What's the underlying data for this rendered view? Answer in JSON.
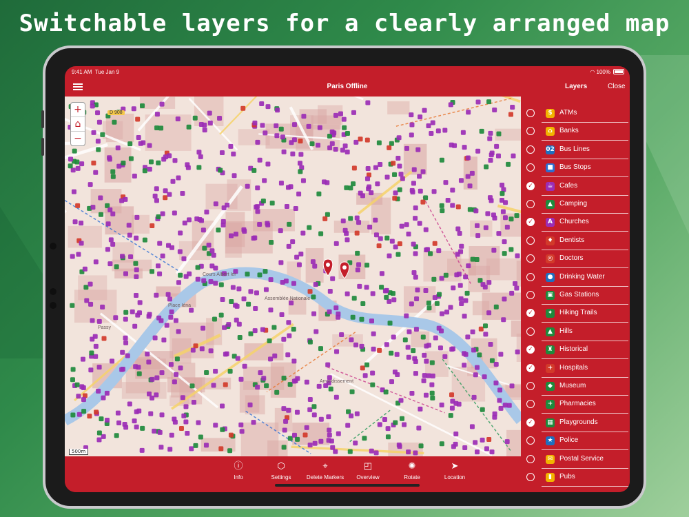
{
  "headline": "Switchable layers for a clearly arranged map",
  "status_bar": {
    "time": "9:41 AM",
    "date": "Tue Jan 9",
    "battery": "100%"
  },
  "nav": {
    "title": "Paris Offline",
    "layers_label": "Layers",
    "close_label": "Close"
  },
  "map": {
    "scale_label": "500m",
    "road_label": "D 908",
    "place_labels": [
      "Cours Albert Ier",
      "Assemblée Nationale",
      "Place Iéna",
      "Passy",
      "Arrondissement"
    ],
    "colors": {
      "base": "#f2e4dc",
      "blocks": "#d9a6a3",
      "river": "#a9c8e8",
      "poi_purple": "#9b2db5",
      "poi_green": "#1e8a3c"
    }
  },
  "toolbar": [
    {
      "label": "Info",
      "icon": "info-icon",
      "glyph": "ⓘ"
    },
    {
      "label": "Settings",
      "icon": "cube-icon",
      "glyph": "⬡"
    },
    {
      "label": "Delete Markers",
      "icon": "pin-icon",
      "glyph": "⌖"
    },
    {
      "label": "Overview",
      "icon": "overview-icon",
      "glyph": "◰"
    },
    {
      "label": "Rotate",
      "icon": "compass-icon",
      "glyph": "✺"
    },
    {
      "label": "Location",
      "icon": "location-arrow-icon",
      "glyph": "➤"
    }
  ],
  "layers": [
    {
      "label": "ATMs",
      "checked": false,
      "icon": "atm-icon",
      "glyph": "$",
      "color": "#f2b300"
    },
    {
      "label": "Banks",
      "checked": false,
      "icon": "bank-icon",
      "glyph": "⌂",
      "color": "#f2b300"
    },
    {
      "label": "Bus Lines",
      "checked": false,
      "icon": "bus-line-icon",
      "glyph": "02",
      "color": "#1e6fbf"
    },
    {
      "label": "Bus Stops",
      "checked": false,
      "icon": "bus-stop-icon",
      "glyph": "■",
      "color": "#2d6fd0"
    },
    {
      "label": "Cafes",
      "checked": true,
      "icon": "cafe-icon",
      "glyph": "☕",
      "color": "#9b2db5"
    },
    {
      "label": "Camping",
      "checked": false,
      "icon": "camping-icon",
      "glyph": "▲",
      "color": "#1e8a3c"
    },
    {
      "label": "Churches",
      "checked": true,
      "icon": "church-icon",
      "glyph": "A",
      "color": "#9b2db5"
    },
    {
      "label": "Dentists",
      "checked": false,
      "icon": "dentist-icon",
      "glyph": "♦",
      "color": "#d23a2a"
    },
    {
      "label": "Doctors",
      "checked": false,
      "icon": "doctor-icon",
      "glyph": "◎",
      "color": "#d23a2a"
    },
    {
      "label": "Drinking Water",
      "checked": false,
      "icon": "water-icon",
      "glyph": "●",
      "color": "#1e6fbf"
    },
    {
      "label": "Gas Stations",
      "checked": false,
      "icon": "gas-station-icon",
      "glyph": "▣",
      "color": "#1e8a3c"
    },
    {
      "label": "Hiking Trails",
      "checked": true,
      "icon": "hiking-icon",
      "glyph": "✦",
      "color": "#1e8a3c"
    },
    {
      "label": "Hills",
      "checked": false,
      "icon": "hill-icon",
      "glyph": "▲",
      "color": "#1e8a3c"
    },
    {
      "label": "Historical",
      "checked": true,
      "icon": "historical-icon",
      "glyph": "♜",
      "color": "#1e8a3c"
    },
    {
      "label": "Hospitals",
      "checked": true,
      "icon": "hospital-icon",
      "glyph": "+",
      "color": "#d23a2a"
    },
    {
      "label": "Museum",
      "checked": false,
      "icon": "museum-icon",
      "glyph": "◆",
      "color": "#1e8a3c"
    },
    {
      "label": "Pharmacies",
      "checked": false,
      "icon": "pharmacy-icon",
      "glyph": "+",
      "color": "#1e8a3c"
    },
    {
      "label": "Playgrounds",
      "checked": true,
      "icon": "playground-icon",
      "glyph": "▦",
      "color": "#1e8a3c"
    },
    {
      "label": "Police",
      "checked": false,
      "icon": "police-icon",
      "glyph": "★",
      "color": "#1e6fbf"
    },
    {
      "label": "Postal Service",
      "checked": false,
      "icon": "post-icon",
      "glyph": "✉",
      "color": "#f2b300"
    },
    {
      "label": "Pubs",
      "checked": false,
      "icon": "pub-icon",
      "glyph": "▮",
      "color": "#f2b300"
    }
  ]
}
